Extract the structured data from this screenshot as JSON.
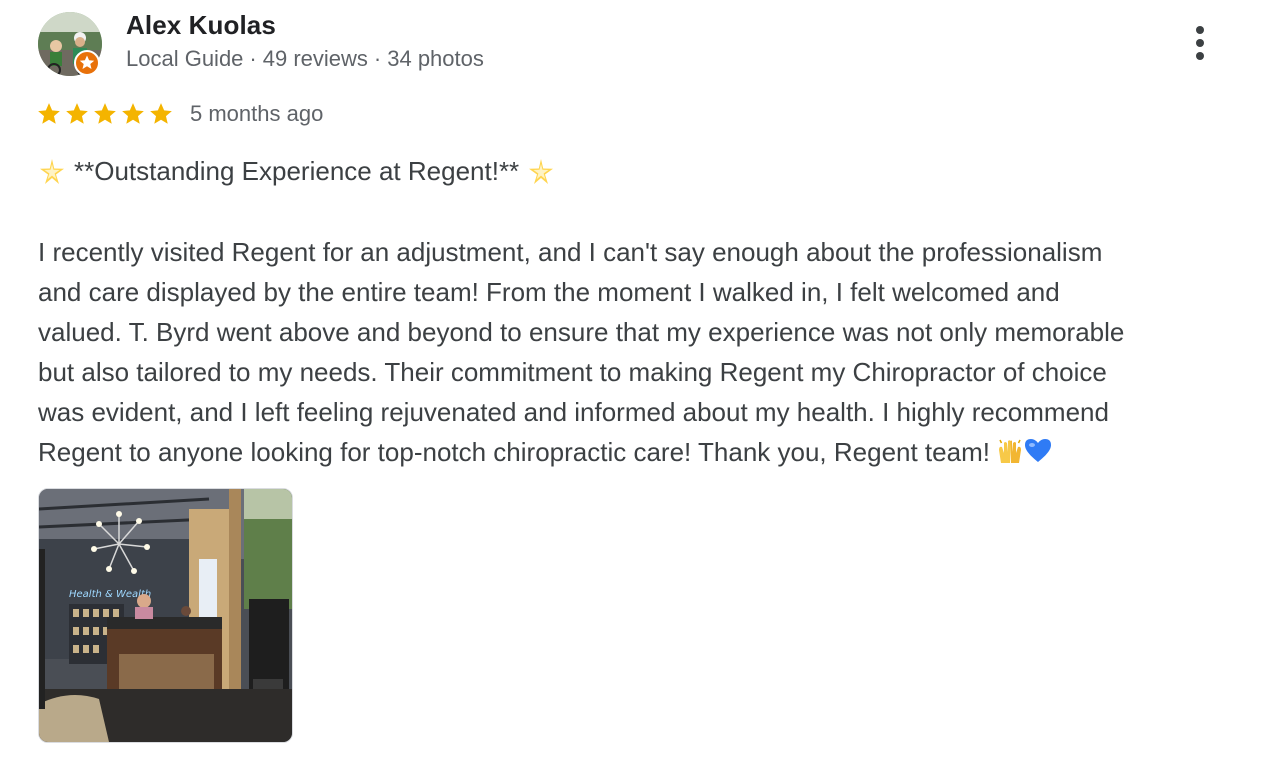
{
  "reviewer": {
    "name": "Alex Kuolas",
    "level": "Local Guide",
    "reviews": "49 reviews",
    "photos": "34 photos",
    "separator": "·"
  },
  "rating": {
    "stars": 5,
    "max": 5,
    "star_color": "#f4b400",
    "time_ago": "5 months ago"
  },
  "review": {
    "headline": "**Outstanding Experience at Regent!**",
    "headline_icon": "glowing-star-emoji",
    "lines": [
      "I recently visited Regent for an adjustment, and I can't say enough about the professionalism",
      "and care displayed by the entire team! From the moment I walked in, I felt welcomed and",
      "valued. T. Byrd went above and beyond to ensure that my experience was not only memorable",
      "but also tailored to my needs. Their commitment to making Regent my Chiropractor of choice",
      "was evident, and I left feeling rejuvenated and informed about my health. I highly recommend",
      "Regent to anyone looking for top-notch chiropractic care! Thank you, Regent team!"
    ],
    "trailing_emojis": [
      "raising-hands-emoji",
      "blue-heart-emoji"
    ]
  },
  "photo": {
    "description_icon": "clinic-reception-photo"
  },
  "menu": {
    "icon": "more-vert-icon"
  },
  "colors": {
    "name": "#202124",
    "meta": "#5f6368",
    "text": "#3c4043",
    "guide_badge": "#e8710a"
  }
}
